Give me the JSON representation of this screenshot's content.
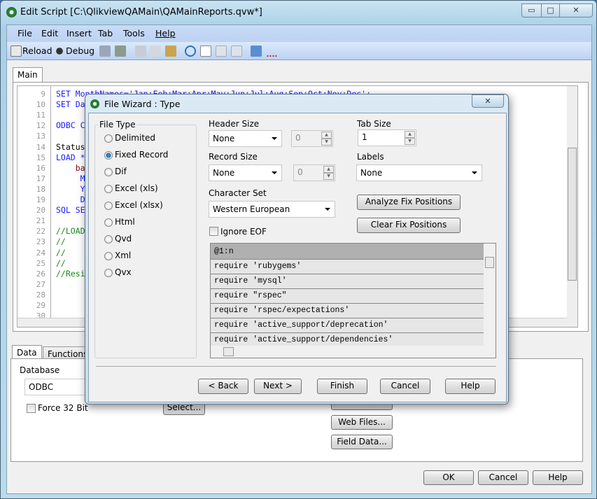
{
  "window": {
    "title": "Edit Script [C:\\QlikviewQAMain\\QAMainReports.qvw*]",
    "minimize": "▭",
    "maximize": "□",
    "close": "✕"
  },
  "menu": [
    "File",
    "Edit",
    "Insert",
    "Tab",
    "Tools",
    "Help"
  ],
  "toolbar": {
    "reload": "Reload",
    "debug": "Debug"
  },
  "script_tabs": [
    "Main"
  ],
  "editor": {
    "lines": [
      {
        "n": "9",
        "t": "SET MonthNames='Jan;Feb;Mar;Apr;May;Jun;Jul;Aug;Sep;Oct;Nov;Dec';",
        "c": "kw"
      },
      {
        "n": "10",
        "t": "SET Da",
        "c": "kw"
      },
      {
        "n": "11",
        "t": "",
        "c": ""
      },
      {
        "n": "12",
        "t": "ODBC C",
        "c": "kw"
      },
      {
        "n": "13",
        "t": "",
        "c": ""
      },
      {
        "n": "14",
        "t": "Status",
        "c": ""
      },
      {
        "n": "15",
        "t": "LOAD *",
        "c": "kw"
      },
      {
        "n": "16",
        "t": "    ba",
        "c": "dr"
      },
      {
        "n": "17",
        "t": "     M",
        "c": "kw"
      },
      {
        "n": "18",
        "t": "     Y",
        "c": "kw"
      },
      {
        "n": "19",
        "t": "     D",
        "c": "kw"
      },
      {
        "n": "20",
        "t": "SQL SE",
        "c": "kw"
      },
      {
        "n": "21",
        "t": "",
        "c": ""
      },
      {
        "n": "22",
        "t": "//LOAD",
        "c": "cm"
      },
      {
        "n": "23",
        "t": "//",
        "c": "cm"
      },
      {
        "n": "24",
        "t": "//",
        "c": "cm"
      },
      {
        "n": "25",
        "t": "//",
        "c": "cm"
      },
      {
        "n": "26",
        "t": "//Resi",
        "c": "cm"
      },
      {
        "n": "27",
        "t": "",
        "c": ""
      },
      {
        "n": "28",
        "t": "",
        "c": ""
      },
      {
        "n": "29",
        "t": "",
        "c": ""
      },
      {
        "n": "30",
        "t": "",
        "c": ""
      }
    ]
  },
  "bottom": {
    "tabs": [
      "Data",
      "Functions"
    ],
    "database_label": "Database",
    "database_value": "ODBC",
    "force32": "Force 32 Bit",
    "select_btn": "Select...",
    "web_files": "Web Files...",
    "field_data": "Field Data..."
  },
  "footer": {
    "ok": "OK",
    "cancel": "Cancel",
    "help": "Help"
  },
  "dialog": {
    "title": "File Wizard : Type",
    "close": "✕",
    "file_type_label": "File Type",
    "file_types": [
      "Delimited",
      "Fixed Record",
      "Dif",
      "Excel (xls)",
      "Excel (xlsx)",
      "Html",
      "Qvd",
      "Xml",
      "Qvx"
    ],
    "selected_file_type": "Fixed Record",
    "header_size": {
      "label": "Header Size",
      "value": "None",
      "spin": "0"
    },
    "record_size": {
      "label": "Record Size",
      "value": "None",
      "spin": "0"
    },
    "tab_size": {
      "label": "Tab Size",
      "value": "1"
    },
    "labels": {
      "label": "Labels",
      "value": "None"
    },
    "charset": {
      "label": "Character Set",
      "value": "Western European"
    },
    "ignore_eof": {
      "label": "Ignore EOF",
      "checked": false
    },
    "analyze_btn": "Analyze Fix Positions",
    "clear_btn": "Clear Fix Positions",
    "grid": {
      "header": "@1:n",
      "rows": [
        "require 'rubygems'",
        "require 'mysql'",
        "require \"rspec\"",
        "require 'rspec/expectations'",
        "require 'active_support/deprecation'",
        "require 'active_support/dependencies'"
      ]
    },
    "buttons": {
      "back": "< Back",
      "next": "Next >",
      "finish": "Finish",
      "cancel": "Cancel",
      "help": "Help"
    }
  }
}
